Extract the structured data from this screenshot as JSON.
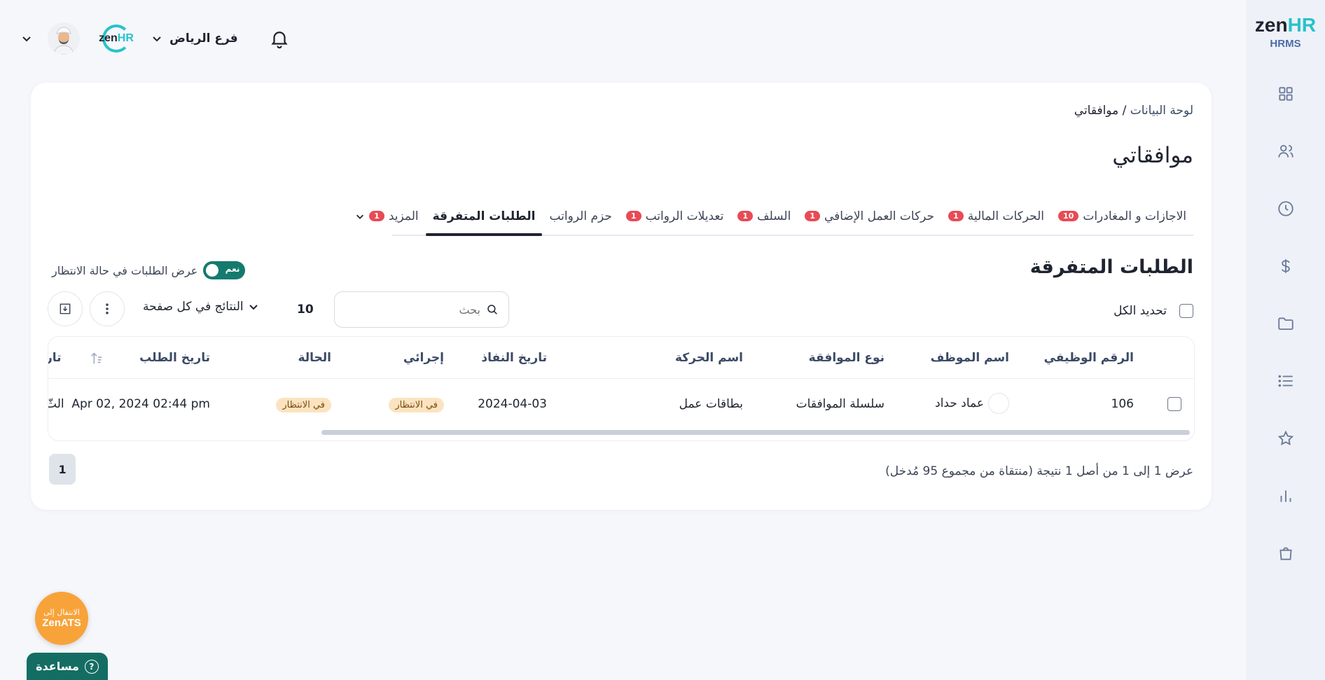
{
  "brand": {
    "logo_main": "zen",
    "logo_accent": "HR",
    "logo_sub": "HRMS",
    "accent_color": "#27c2cc",
    "primary_color": "#146d63"
  },
  "topbar": {
    "branch": "فرع الرياض",
    "mini_logo_main": "zen",
    "mini_logo_accent": "HR"
  },
  "sidebar": {
    "icons": [
      "dashboard-icon",
      "people-icon",
      "clock-icon",
      "dollar-icon",
      "folder-icon",
      "list-icon",
      "star-icon",
      "bar-chart-icon",
      "shopping-bag-icon"
    ]
  },
  "breadcrumb": {
    "home": "لوحة البيانات",
    "separator": " / ",
    "current": "موافقاتي"
  },
  "page_title": "موافقاتي",
  "tabs": [
    {
      "label": "الاجازات و المغادرات",
      "badge": "10"
    },
    {
      "label": "الحركات المالية",
      "badge": "1"
    },
    {
      "label": "حركات العمل الإضافي",
      "badge": "1"
    },
    {
      "label": "السلف",
      "badge": "1"
    },
    {
      "label": "تعديلات الرواتب",
      "badge": "1"
    },
    {
      "label": "حزم الرواتب",
      "badge": ""
    },
    {
      "label": "الطلبات المتفرقة",
      "badge": ""
    },
    {
      "label": "المزيد",
      "badge": "1"
    }
  ],
  "section_title": "الطلبات المتفرقة",
  "pending_toggle": {
    "label": "عرض الطلبات في حالة الانتظار",
    "state": "نعم"
  },
  "select_all": "تحديد الكل",
  "search": {
    "placeholder": "بحث"
  },
  "per_page": {
    "value": "10",
    "label": "النتائج في كل صفحة"
  },
  "table": {
    "headers": {
      "employee_id": "الرقم الوظيفي",
      "employee_name": "اسم الموظف",
      "approval_type": "نوع الموافقة",
      "transaction_name": "اسم الحركة",
      "effective_date": "تاريخ النفاذ",
      "my_action": "إجرائي",
      "status": "الحالة",
      "request_date": "تاريخ الطلب",
      "next_col": "تار"
    },
    "rows": [
      {
        "employee_id": "106",
        "employee_name": "عماد حداد",
        "approval_type": "سلسلة الموافقات",
        "transaction_name": "بطاقات عمل",
        "effective_date": "2024-04-03",
        "my_action": "في الانتظار",
        "status": "في الانتظار",
        "request_date": "Apr 02, 2024 02:44 pm",
        "next_col": "الثّ"
      }
    ]
  },
  "result_info": "عرض 1 إلى 1 من أصل 1 نتيجة (منتقاة من مجموع 95 مُدخل)",
  "pagination": {
    "current": "1"
  },
  "zenats": {
    "line1": "الانتقال إلى",
    "line2": "ZenATS"
  },
  "help": {
    "label": "مساعدة",
    "icon_text": "?"
  }
}
